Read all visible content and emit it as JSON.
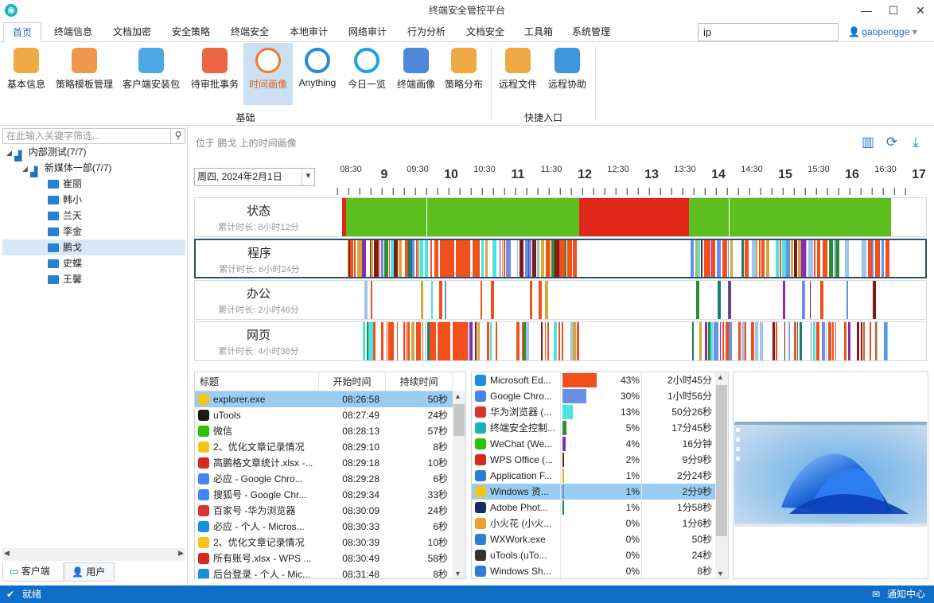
{
  "app": {
    "title": "终端安全管控平台",
    "user": "gaopengge"
  },
  "window_controls": {
    "minimize": "—",
    "maximize": "☐",
    "close": "✕"
  },
  "menu": [
    "首页",
    "终端信息",
    "文档加密",
    "安全策略",
    "终端安全",
    "本地审计",
    "网络审计",
    "行为分析",
    "文档安全",
    "工具箱",
    "系统管理"
  ],
  "search": {
    "value": "ip"
  },
  "ribbon": {
    "buttons": [
      "基本信息",
      "策略模板管理",
      "客户端安装包",
      "待审批事务",
      "时间画像",
      "Anything",
      "今日一览",
      "终端画像",
      "策略分布",
      "远程文件",
      "远程协助"
    ],
    "group_basic": "基础",
    "group_quick": "快捷入口"
  },
  "tree": {
    "search_placeholder": "在此输入关键字筛选...",
    "root": "内部测试(7/7)",
    "dept": "新媒体一部(7/7)",
    "users": [
      "崔丽",
      "韩小",
      "兰天",
      "李金",
      "鹏戈",
      "史蝶",
      "王馨"
    ]
  },
  "bottom_tabs": [
    "客户端",
    "用户"
  ],
  "breadcrumb": "位于 鹏戈 上的时间画像",
  "date": "周四, 2024年2月1日",
  "timeline": {
    "hours": [
      "9",
      "10",
      "11",
      "12",
      "13",
      "14",
      "15",
      "16",
      "17"
    ],
    "half_hours": [
      "08:30",
      "09:30",
      "10:30",
      "11:30",
      "12:30",
      "13:30",
      "14:30",
      "15:30",
      "16:30"
    ]
  },
  "rows": [
    {
      "title": "状态",
      "sub": "累计时长: 8小时12分"
    },
    {
      "title": "程序",
      "sub": "累计时长: 6小时24分"
    },
    {
      "title": "办公",
      "sub": "累计时长: 2小时46分"
    },
    {
      "title": "网页",
      "sub": "累计时长: 4小时38分"
    }
  ],
  "proc_table": {
    "headers": [
      "标题",
      "开始时间",
      "持续时间"
    ],
    "rows": [
      {
        "title": "explorer.exe",
        "start": "08:26:58",
        "dur": "50秒"
      },
      {
        "title": "uTools",
        "start": "08:27:49",
        "dur": "24秒"
      },
      {
        "title": "微信",
        "start": "08:28:13",
        "dur": "57秒"
      },
      {
        "title": "2、优化文章记录情况",
        "start": "08:29:10",
        "dur": "8秒"
      },
      {
        "title": "高鹏格文章统计.xlsx -...",
        "start": "08:29:18",
        "dur": "10秒"
      },
      {
        "title": "必应 - Google Chro...",
        "start": "08:29:28",
        "dur": "6秒"
      },
      {
        "title": "搜狐号 - Google Chr...",
        "start": "08:29:34",
        "dur": "33秒"
      },
      {
        "title": "百家号 -华为浏览器",
        "start": "08:30:09",
        "dur": "24秒"
      },
      {
        "title": "必应 - 个人 - Micros...",
        "start": "08:30:33",
        "dur": "6秒"
      },
      {
        "title": "2、优化文章记录情况",
        "start": "08:30:39",
        "dur": "10秒"
      },
      {
        "title": "所有账号.xlsx - WPS ...",
        "start": "08:30:49",
        "dur": "58秒"
      },
      {
        "title": "后台登录 - 个人 - Mic...",
        "start": "08:31:48",
        "dur": "8秒"
      }
    ]
  },
  "app_table": {
    "rows": [
      {
        "name": "Microsoft Ed...",
        "pct": "43%",
        "dur": "2小时45分",
        "share": 0.43
      },
      {
        "name": "Google Chro...",
        "pct": "30%",
        "dur": "1小时56分",
        "share": 0.3
      },
      {
        "name": "华为浏览器 (...",
        "pct": "13%",
        "dur": "50分26秒",
        "share": 0.13
      },
      {
        "name": "终端安全控制...",
        "pct": "5%",
        "dur": "17分45秒",
        "share": 0.05
      },
      {
        "name": "WeChat (We...",
        "pct": "4%",
        "dur": "16分钟",
        "share": 0.04
      },
      {
        "name": "WPS Office (...",
        "pct": "2%",
        "dur": "9分9秒",
        "share": 0.02
      },
      {
        "name": "Application F...",
        "pct": "1%",
        "dur": "2分24秒",
        "share": 0.01
      },
      {
        "name": "Windows 资...",
        "pct": "1%",
        "dur": "2分9秒",
        "share": 0.01
      },
      {
        "name": "Adobe Phot...",
        "pct": "1%",
        "dur": "1分58秒",
        "share": 0.01
      },
      {
        "name": "小火花 (小火...",
        "pct": "0%",
        "dur": "1分6秒",
        "share": 0.0
      },
      {
        "name": "WXWork.exe",
        "pct": "0%",
        "dur": "50秒",
        "share": 0.0
      },
      {
        "name": "uTools (uTo...",
        "pct": "0%",
        "dur": "24秒",
        "share": 0.0
      },
      {
        "name": "Windows Sh...",
        "pct": "0%",
        "dur": "8秒",
        "share": 0.0
      }
    ]
  },
  "status": {
    "left": "就绪",
    "right": "通知中心"
  },
  "colors": {
    "accent": "#1f6fc5",
    "status_bar": "#0f6fc6",
    "green": "#5cbf1f",
    "red": "#e0281a",
    "orange": "#f1501c"
  }
}
